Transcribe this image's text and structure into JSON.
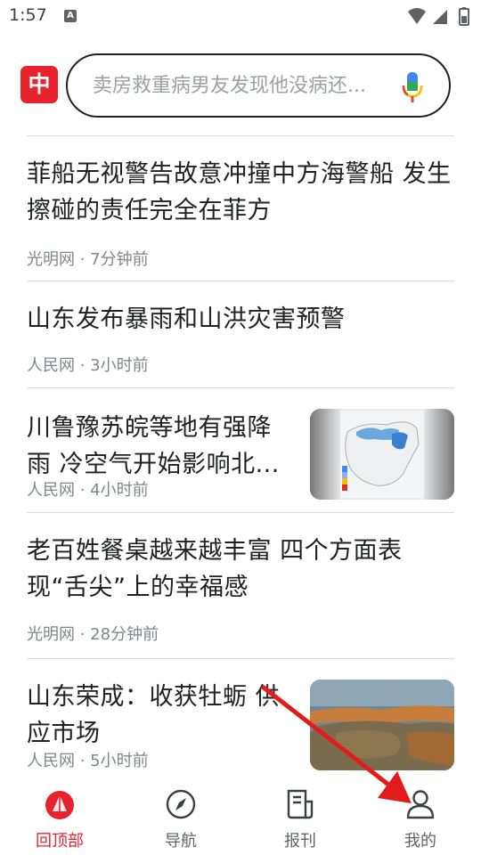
{
  "status": {
    "time": "1:57",
    "notification_letter": "A",
    "icons": [
      "wifi-icon",
      "signal-icon",
      "battery-icon"
    ]
  },
  "header": {
    "logo_text": "中",
    "search_placeholder": "卖房救重病男友发现他没病还...",
    "mic_icon": "mic-icon"
  },
  "feed": {
    "items": [
      {
        "title": "菲船无视警告故意冲撞中方海警船 发生擦碰的责任完全在菲方",
        "meta": "光明网 · 7分钟前",
        "has_thumb": false
      },
      {
        "title": "山东发布暴雨和山洪灾害预警",
        "meta": "人民网 · 3小时前",
        "has_thumb": false
      },
      {
        "title": "川鲁豫苏皖等地有强降雨 冷空气开始影响北...",
        "meta": "人民网 · 4小时前",
        "has_thumb": true,
        "thumb": "weather-map-thumbnail"
      },
      {
        "title": "老百姓餐桌越来越丰富 四个方面表现“舌尖”上的幸福感",
        "meta": "光明网 · 28分钟前",
        "has_thumb": false
      },
      {
        "title": "山东荣成：收获牡蛎 供应市场",
        "meta": "人民网 · 5小时前",
        "has_thumb": true,
        "thumb": "oyster-harvest-thumbnail"
      }
    ]
  },
  "bottom_nav": {
    "items": [
      {
        "label": "回顶部",
        "icon": "back-to-top-icon",
        "active": true
      },
      {
        "label": "导航",
        "icon": "compass-icon",
        "active": false
      },
      {
        "label": "报刊",
        "icon": "newspaper-icon",
        "active": false
      },
      {
        "label": "我的",
        "icon": "profile-icon",
        "active": false
      }
    ]
  },
  "colors": {
    "accent": "#e8232c",
    "text": "#202124",
    "meta": "#80868b",
    "divider": "#dadce0"
  }
}
